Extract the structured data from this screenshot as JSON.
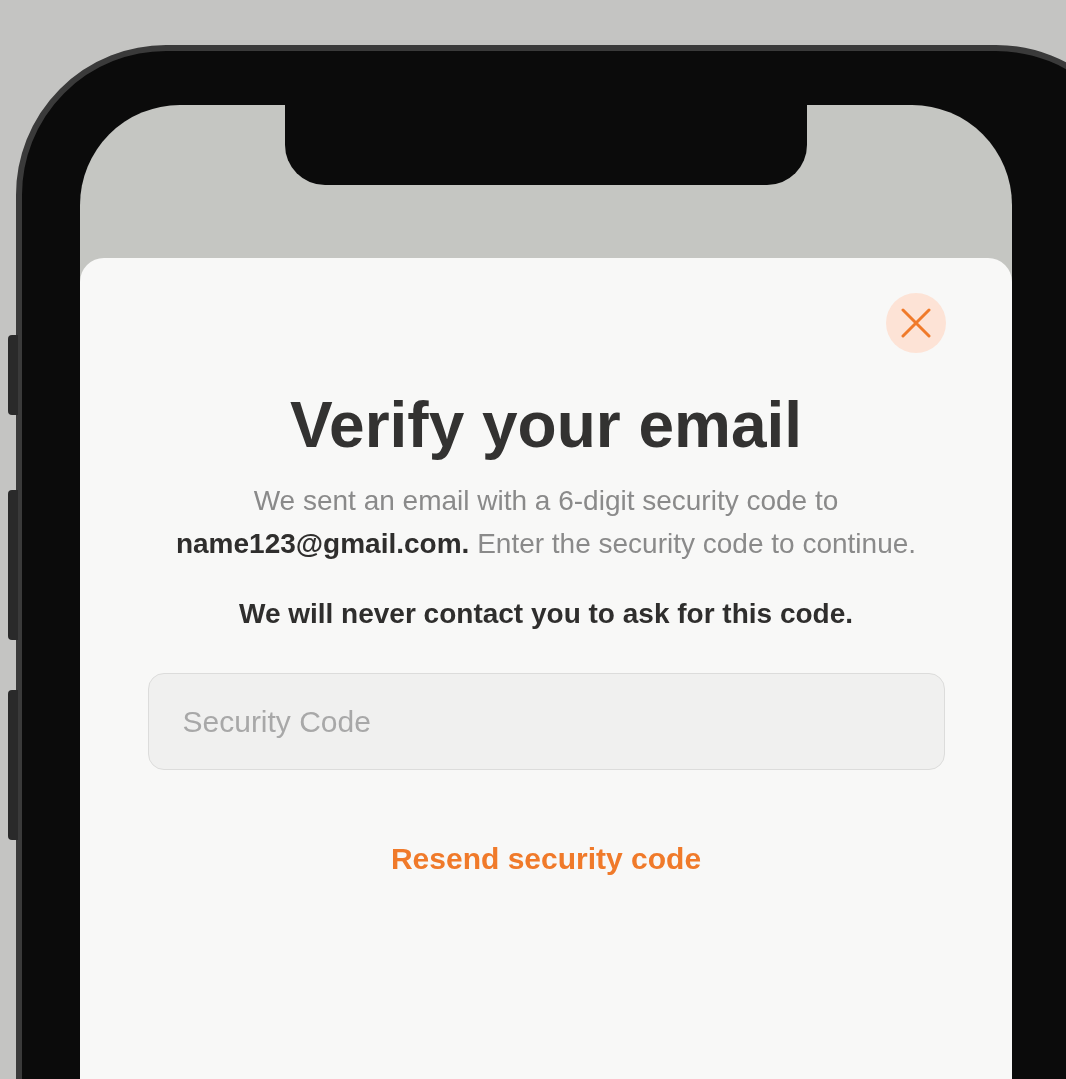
{
  "dialog": {
    "title": "Verify your email",
    "message": "We sent an email with a 6-digit security code to **name123@gmail.com.** Enter the security code to continue.",
    "warning": "We will never contact you to ask for this code.",
    "code_field": {
      "placeholder": "Security Code"
    },
    "resend_link": "Resend security code"
  }
}
